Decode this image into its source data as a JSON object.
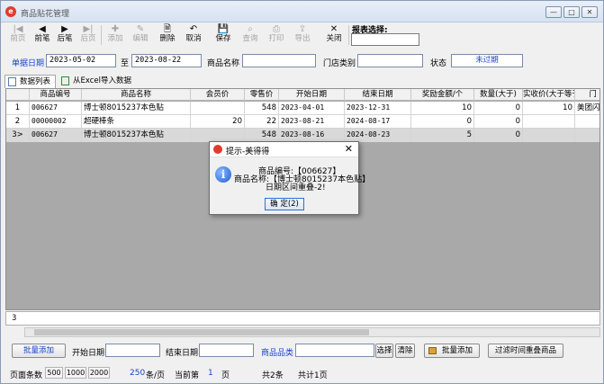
{
  "window": {
    "title": "商品贴花管理",
    "app_icon": "e"
  },
  "toolbar": {
    "items": [
      {
        "label": "前页",
        "icon": "|◀",
        "enabled": false
      },
      {
        "label": "前笔",
        "icon": "◀",
        "enabled": true
      },
      {
        "label": "后笔",
        "icon": "▶",
        "enabled": true
      },
      {
        "label": "后页",
        "icon": "▶|",
        "enabled": false
      },
      {
        "label": "添加",
        "icon": "✚",
        "enabled": false
      },
      {
        "label": "编辑",
        "icon": "✎",
        "enabled": false
      },
      {
        "label": "删除",
        "icon": "🗎",
        "enabled": true
      },
      {
        "label": "取消",
        "icon": "↶",
        "enabled": true
      },
      {
        "label": "保存",
        "icon": "💾",
        "enabled": true
      },
      {
        "label": "查询",
        "icon": "⌕",
        "enabled": false
      },
      {
        "label": "打印",
        "icon": "⎙",
        "enabled": false
      },
      {
        "label": "导出",
        "icon": "⇪",
        "enabled": false
      },
      {
        "label": "关闭",
        "icon": "✕",
        "enabled": true
      }
    ],
    "report_label": "报表选择:"
  },
  "filter": {
    "date_label": "单据日期",
    "date_from": "2023-05-02",
    "to_label": "至",
    "date_to": "2023-08-22",
    "product_label": "商品名称",
    "store_label": "门店类别",
    "status_label": "状态",
    "status_value": "未过期"
  },
  "tabs": [
    "数据列表",
    "从Excel导入数据"
  ],
  "grid": {
    "columns": [
      "",
      "商品编号",
      "商品名称",
      "会员价",
      "零售价",
      "开始日期",
      "结束日期",
      "奖励金额/个",
      "数量(大于)",
      "实收价(大于等于)",
      "门"
    ],
    "rows": [
      {
        "n": "1",
        "code": "006627",
        "name": "博士顿8015237本色贴",
        "member": "",
        "retail": "548",
        "start": "2023-04-01",
        "end": "2023-12-31",
        "reward": "10",
        "qty": "0",
        "actual": "10",
        "extra": "美团闪购"
      },
      {
        "n": "2",
        "code": "00000002",
        "name": "超硬棒条",
        "member": "20",
        "retail": "22",
        "start": "2023-08-21",
        "end": "2024-08-17",
        "reward": "0",
        "qty": "0",
        "actual": "",
        "extra": ""
      },
      {
        "n": "3>",
        "code": "006627",
        "name": "博士顿8015237本色贴",
        "member": "",
        "retail": "548",
        "start": "2023-08-16",
        "end": "2024-08-23",
        "reward": "5",
        "qty": "0",
        "actual": "",
        "extra": ""
      }
    ],
    "footer_count": "3"
  },
  "bottom": {
    "batch_add": "批量添加",
    "start_label": "开始日期",
    "end_label": "结束日期",
    "category_label": "商品品类",
    "select_btn": "选择",
    "clear_btn": "清除",
    "batch_add2": "批量添加",
    "filter_btn": "过滤时间重叠商品"
  },
  "pager": {
    "size_label": "页面条数",
    "sizes": [
      "500",
      "1000",
      "2000"
    ],
    "per_page": "250",
    "per_page_unit": "条/页",
    "current_label": "当前第",
    "current": "1",
    "page_unit": "页",
    "total_rows": "共2条",
    "total_pages": "共计1页"
  },
  "dialog": {
    "title": "提示-美得得",
    "line1": "商品编号:【006627】",
    "line2": "商品名称:【博士顿8015237本色贴】",
    "line3": "日期区间重叠-2!",
    "ok": "确 定(2)"
  }
}
